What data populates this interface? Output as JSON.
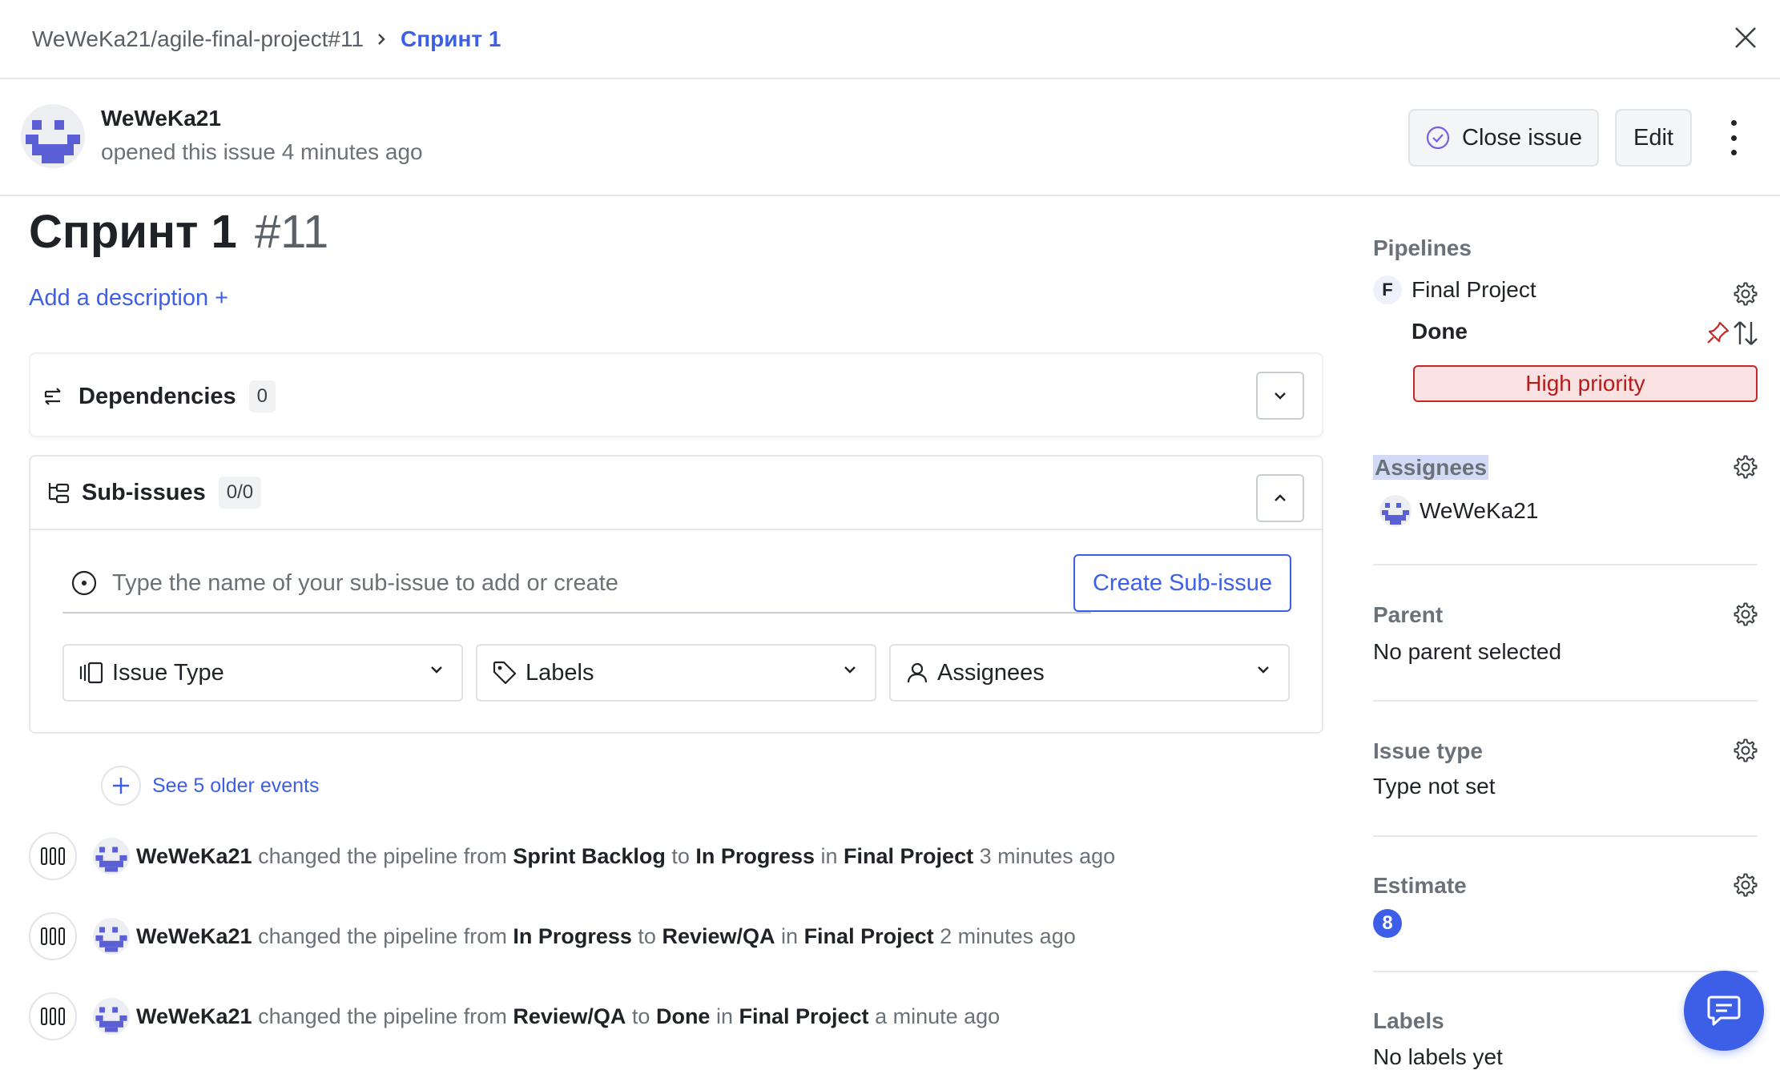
{
  "breadcrumb": {
    "repo": "WeWeKa21/agile-final-project#11",
    "current": "Спринт 1"
  },
  "author": {
    "name": "WeWeKa21",
    "meta": "opened this issue 4 minutes ago"
  },
  "actions": {
    "close_issue": "Close issue",
    "edit": "Edit"
  },
  "issue": {
    "title": "Спринт 1",
    "number": "#11",
    "add_description": "Add a description +"
  },
  "dependencies": {
    "label": "Dependencies",
    "count": "0"
  },
  "sub_issues": {
    "label": "Sub-issues",
    "count": "0/0",
    "input_placeholder": "Type the name of your sub-issue to add or create",
    "create_label": "Create Sub-issue",
    "filters": [
      "Issue Type",
      "Labels",
      "Assignees"
    ]
  },
  "timeline": {
    "older_events": "See 5 older events",
    "events": [
      {
        "user": "WeWeKa21",
        "verb": "changed the pipeline from",
        "from": "Sprint Backlog",
        "to_word": "to",
        "to": "In Progress",
        "in_word": "in",
        "pipeline": "Final Project",
        "time": "3 minutes ago"
      },
      {
        "user": "WeWeKa21",
        "verb": "changed the pipeline from",
        "from": "In Progress",
        "to_word": "to",
        "to": "Review/QA",
        "in_word": "in",
        "pipeline": "Final Project",
        "time": "2 minutes ago"
      },
      {
        "user": "WeWeKa21",
        "verb": "changed the pipeline from",
        "from": "Review/QA",
        "to_word": "to",
        "to": "Done",
        "in_word": "in",
        "pipeline": "Final Project",
        "time": "a minute ago"
      }
    ]
  },
  "sidebar": {
    "pipelines": {
      "heading": "Pipelines",
      "badge": "F",
      "name": "Final Project",
      "stage": "Done",
      "priority": "High priority"
    },
    "assignees": {
      "heading": "Assignees",
      "user": "WeWeKa21"
    },
    "parent": {
      "heading": "Parent",
      "value": "No parent selected"
    },
    "issue_type": {
      "heading": "Issue type",
      "value": "Type not set"
    },
    "estimate": {
      "heading": "Estimate",
      "value": "8"
    },
    "labels": {
      "heading": "Labels",
      "value": "No labels yet"
    }
  },
  "colors": {
    "accent": "#3d5fe8",
    "priority_border": "#c62828",
    "priority_bg": "#fbe2e2",
    "avatar_purple": "#5b5fd6"
  },
  "icons": [
    "chevron-right-icon",
    "close-icon",
    "check-circle-icon",
    "kebab-icon",
    "dependencies-icon",
    "sub-issues-icon",
    "chevron-down-icon",
    "chevron-up-icon",
    "circle-dot-icon",
    "issue-type-icon",
    "tag-icon",
    "user-icon",
    "plus-icon",
    "pipeline-icon",
    "gear-icon",
    "pin-icon",
    "swap-icon",
    "chat-icon"
  ]
}
